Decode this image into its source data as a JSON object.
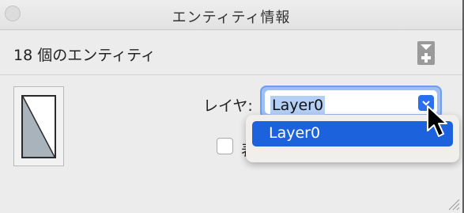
{
  "window": {
    "title": "エンティティ情報"
  },
  "header": {
    "entity_count": "18 個のエンティティ",
    "toggle_icon": "expand-details-icon"
  },
  "preview": {
    "icon": "component-preview-icon"
  },
  "layer": {
    "label": "レイヤ:",
    "selected_value": "Layer0"
  },
  "dropdown": {
    "options": [
      "Layer0"
    ]
  },
  "visibility": {
    "checkbox_label": "表",
    "checked": false
  },
  "colors": {
    "accent": "#1b62dc",
    "focus_ring": "#6f9ef0",
    "window_bg": "#ececec"
  }
}
